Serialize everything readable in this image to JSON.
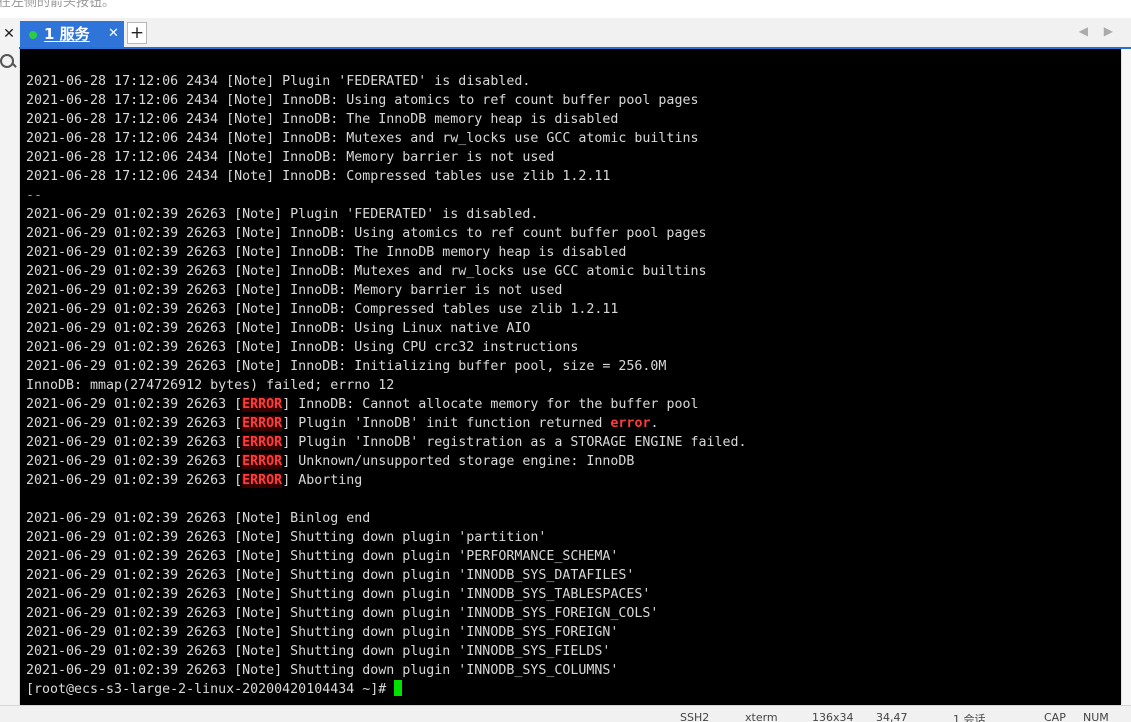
{
  "top_hint_text": "在左侧的箭头按钮。",
  "tabs": [
    {
      "number": "1",
      "label": "服务",
      "status_color": "#2ecc40",
      "active": true,
      "close_glyph": "✕"
    }
  ],
  "add_tab_glyph": "+",
  "left_panel": {
    "close_glyph": "✕"
  },
  "nav_arrows": "◀ ▶",
  "terminal": {
    "lines": [
      [
        {
          "t": "2021-06-28 17:12:06 2434 [Note] Plugin 'FEDERATED' is disabled."
        }
      ],
      [
        {
          "t": "2021-06-28 17:12:06 2434 [Note] InnoDB: Using atomics to ref count buffer pool pages"
        }
      ],
      [
        {
          "t": "2021-06-28 17:12:06 2434 [Note] InnoDB: The InnoDB memory heap is disabled"
        }
      ],
      [
        {
          "t": "2021-06-28 17:12:06 2434 [Note] InnoDB: Mutexes and rw_locks use GCC atomic builtins"
        }
      ],
      [
        {
          "t": "2021-06-28 17:12:06 2434 [Note] InnoDB: Memory barrier is not used"
        }
      ],
      [
        {
          "t": "2021-06-28 17:12:06 2434 [Note] InnoDB: Compressed tables use zlib 1.2.11"
        }
      ],
      [
        {
          "t": "--",
          "c": "t-sep"
        }
      ],
      [
        {
          "t": "2021-06-29 01:02:39 26263 [Note] Plugin 'FEDERATED' is disabled."
        }
      ],
      [
        {
          "t": "2021-06-29 01:02:39 26263 [Note] InnoDB: Using atomics to ref count buffer pool pages"
        }
      ],
      [
        {
          "t": "2021-06-29 01:02:39 26263 [Note] InnoDB: The InnoDB memory heap is disabled"
        }
      ],
      [
        {
          "t": "2021-06-29 01:02:39 26263 [Note] InnoDB: Mutexes and rw_locks use GCC atomic builtins"
        }
      ],
      [
        {
          "t": "2021-06-29 01:02:39 26263 [Note] InnoDB: Memory barrier is not used"
        }
      ],
      [
        {
          "t": "2021-06-29 01:02:39 26263 [Note] InnoDB: Compressed tables use zlib 1.2.11"
        }
      ],
      [
        {
          "t": "2021-06-29 01:02:39 26263 [Note] InnoDB: Using Linux native AIO"
        }
      ],
      [
        {
          "t": "2021-06-29 01:02:39 26263 [Note] InnoDB: Using CPU crc32 instructions"
        }
      ],
      [
        {
          "t": "2021-06-29 01:02:39 26263 [Note] InnoDB: Initializing buffer pool, size = 256.0M"
        }
      ],
      [
        {
          "t": "InnoDB: mmap(274726912 bytes) failed; errno 12"
        }
      ],
      [
        {
          "t": "2021-06-29 01:02:39 26263 ["
        },
        {
          "t": "ERROR",
          "c": "t-err"
        },
        {
          "t": "] InnoDB: Cannot allocate memory for the buffer pool"
        }
      ],
      [
        {
          "t": "2021-06-29 01:02:39 26263 ["
        },
        {
          "t": "ERROR",
          "c": "t-err"
        },
        {
          "t": "] Plugin 'InnoDB' init function returned "
        },
        {
          "t": "error",
          "c": "t-err2"
        },
        {
          "t": "."
        }
      ],
      [
        {
          "t": "2021-06-29 01:02:39 26263 ["
        },
        {
          "t": "ERROR",
          "c": "t-err"
        },
        {
          "t": "] Plugin 'InnoDB' registration as a STORAGE ENGINE failed."
        }
      ],
      [
        {
          "t": "2021-06-29 01:02:39 26263 ["
        },
        {
          "t": "ERROR",
          "c": "t-err"
        },
        {
          "t": "] Unknown/unsupported storage engine: InnoDB"
        }
      ],
      [
        {
          "t": "2021-06-29 01:02:39 26263 ["
        },
        {
          "t": "ERROR",
          "c": "t-err"
        },
        {
          "t": "] Aborting"
        }
      ],
      [
        {
          "t": ""
        }
      ],
      [
        {
          "t": "2021-06-29 01:02:39 26263 [Note] Binlog end"
        }
      ],
      [
        {
          "t": "2021-06-29 01:02:39 26263 [Note] Shutting down plugin 'partition'"
        }
      ],
      [
        {
          "t": "2021-06-29 01:02:39 26263 [Note] Shutting down plugin 'PERFORMANCE_SCHEMA'"
        }
      ],
      [
        {
          "t": "2021-06-29 01:02:39 26263 [Note] Shutting down plugin 'INNODB_SYS_DATAFILES'"
        }
      ],
      [
        {
          "t": "2021-06-29 01:02:39 26263 [Note] Shutting down plugin 'INNODB_SYS_TABLESPACES'"
        }
      ],
      [
        {
          "t": "2021-06-29 01:02:39 26263 [Note] Shutting down plugin 'INNODB_SYS_FOREIGN_COLS'"
        }
      ],
      [
        {
          "t": "2021-06-29 01:02:39 26263 [Note] Shutting down plugin 'INNODB_SYS_FOREIGN'"
        }
      ],
      [
        {
          "t": "2021-06-29 01:02:39 26263 [Note] Shutting down plugin 'INNODB_SYS_FIELDS'"
        }
      ],
      [
        {
          "t": "2021-06-29 01:02:39 26263 [Note] Shutting down plugin 'INNODB_SYS_COLUMNS'"
        }
      ]
    ],
    "prompt": "[root@ecs-s3-large-2-linux-20200420104434 ~]# ",
    "cursor_color": "#00e000"
  },
  "statusbar": {
    "protocol": "SSH2",
    "term_type": "xterm",
    "size": "136x34",
    "cursor_pos": "34,47",
    "sessions": "1 会话",
    "caps": "CAP",
    "num": "NUM"
  }
}
